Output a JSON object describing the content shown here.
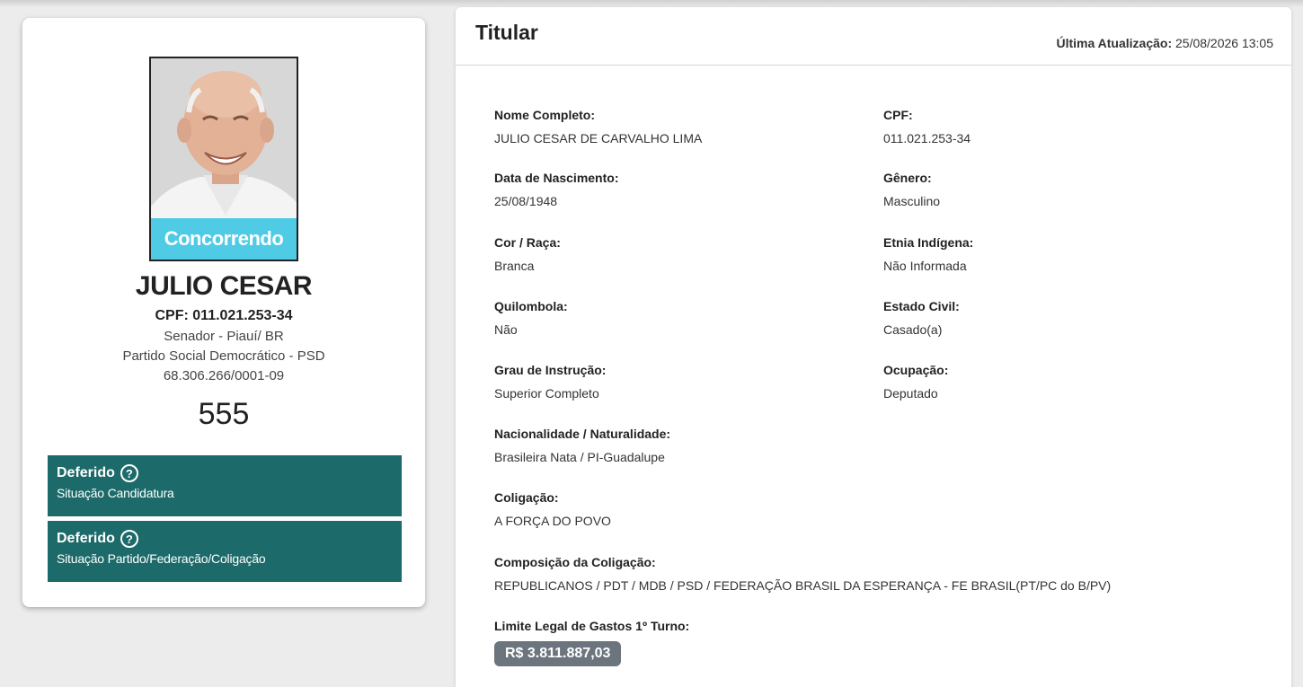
{
  "profile": {
    "photo_status": "Concorrendo",
    "name": "JULIO CESAR",
    "cpf_line": "CPF: 011.021.253-34",
    "office": "Senador - Piauí/ BR",
    "party": "Partido Social Democrático - PSD",
    "cnpj": "68.306.266/0001-09",
    "number": "555",
    "status_boxes": [
      {
        "title": "Deferido",
        "subtitle": "Situação Candidatura"
      },
      {
        "title": "Deferido",
        "subtitle": "Situação Partido/Federação/Coligação"
      }
    ]
  },
  "panel": {
    "title": "Titular",
    "updated_label": "Última Atualização:",
    "updated_value": "25/08/2026 13:05",
    "fields": {
      "nome_completo": {
        "label": "Nome Completo:",
        "value": "JULIO CESAR DE CARVALHO LIMA"
      },
      "cpf": {
        "label": "CPF:",
        "value": "011.021.253-34"
      },
      "nascimento": {
        "label": "Data de Nascimento:",
        "value": "25/08/1948"
      },
      "genero": {
        "label": "Gênero:",
        "value": "Masculino"
      },
      "cor_raca": {
        "label": "Cor / Raça:",
        "value": "Branca"
      },
      "etnia": {
        "label": "Etnia Indígena:",
        "value": "Não Informada"
      },
      "quilombola": {
        "label": "Quilombola:",
        "value": "Não"
      },
      "estado_civil": {
        "label": "Estado Civil:",
        "value": "Casado(a)"
      },
      "instrucao": {
        "label": "Grau de Instrução:",
        "value": "Superior Completo"
      },
      "ocupacao": {
        "label": "Ocupação:",
        "value": "Deputado"
      },
      "nacionalidade": {
        "label": "Nacionalidade / Naturalidade:",
        "value": "Brasileira Nata / PI-Guadalupe"
      },
      "coligacao": {
        "label": "Coligação:",
        "value": "A FORÇA DO POVO"
      },
      "composicao": {
        "label": "Composição da Coligação:",
        "value": "REPUBLICANOS / PDT / MDB / PSD / FEDERAÇÃO BRASIL DA ESPERANÇA - FE BRASIL(PT/PC do B/PV)"
      },
      "limite": {
        "label": "Limite Legal de Gastos 1º Turno:",
        "value": "R$ 3.811.887,03"
      }
    }
  },
  "colors": {
    "status_teal": "#1d6a6a",
    "photo_badge": "#4fcbe6",
    "money_badge": "#6c757d"
  },
  "icons": [
    "help-circle-icon"
  ]
}
